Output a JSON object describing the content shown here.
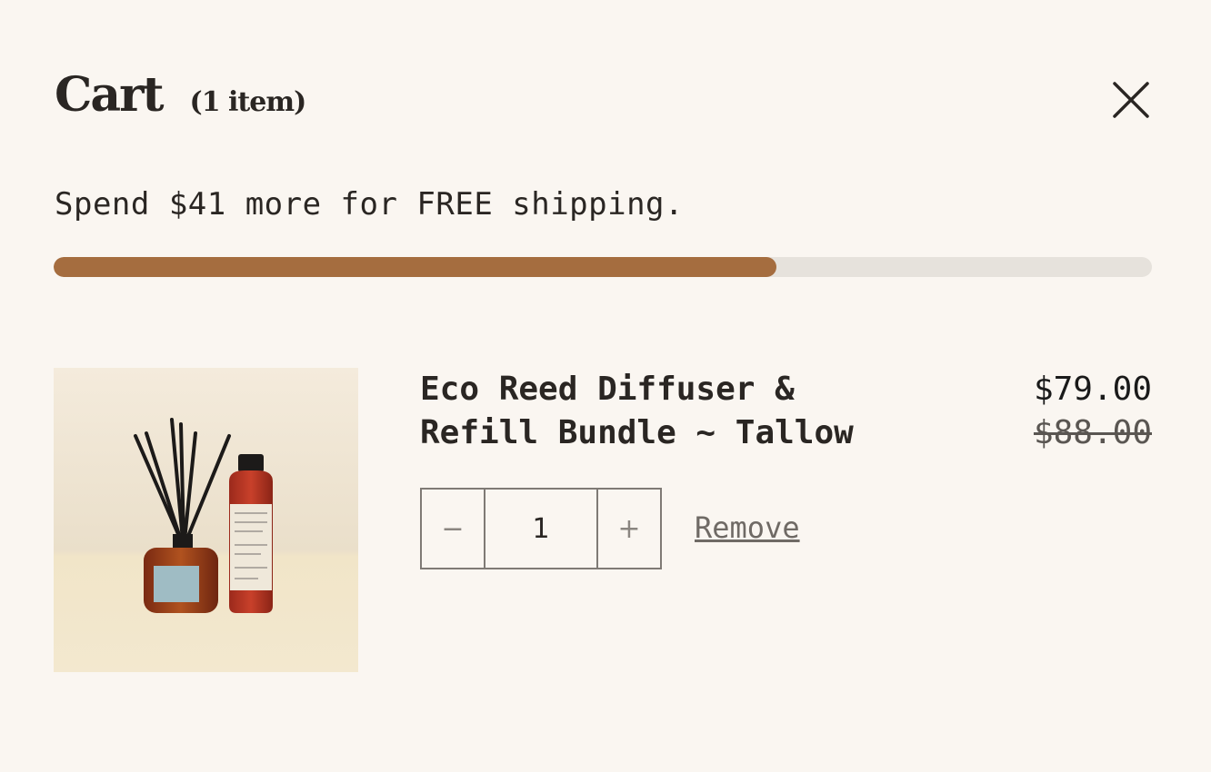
{
  "cart": {
    "title": "Cart",
    "count_label": "(1 item)"
  },
  "close_icon": "close-icon",
  "shipping": {
    "message": "Spend $41 more for FREE shipping.",
    "progress_percent": 65.8,
    "fill_color": "#a56d3f",
    "track_color": "#e6e2dc"
  },
  "item": {
    "name_line1": "Eco Reed Diffuser &",
    "name_line2": "Refill Bundle ~ Tallow",
    "price": "$79.00",
    "compare_price": "$88.00",
    "quantity": "1",
    "decrease_symbol": "−",
    "increase_symbol": "+",
    "remove_label": "Remove"
  },
  "colors": {
    "background": "#faf6f1",
    "text": "#2a2623",
    "accent": "#a56d3f"
  }
}
